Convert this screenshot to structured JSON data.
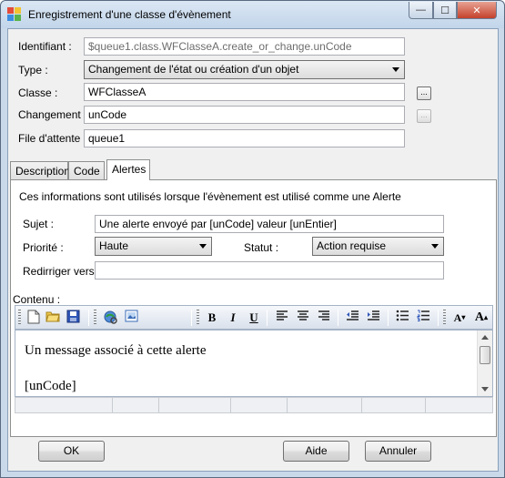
{
  "window": {
    "title": "Enregistrement d'une classe d'évènement",
    "controls": {
      "minimize": "—",
      "maximize": "☐",
      "close": "✕"
    }
  },
  "form": {
    "identifiant": {
      "label": "Identifiant :",
      "value": "$queue1.class.WFClasseA.create_or_change.unCode"
    },
    "type": {
      "label": "Type :",
      "value": "Changement de l'état ou création d'un objet"
    },
    "classe": {
      "label": "Classe :",
      "value": "WFClasseA",
      "button": "..."
    },
    "changement": {
      "label": "Changement :",
      "value": "unCode",
      "button": "..."
    },
    "file_attente": {
      "label": "File d'attente :",
      "value": "queue1"
    }
  },
  "tabs": [
    {
      "label": "Description",
      "active": false
    },
    {
      "label": "Code",
      "active": false
    },
    {
      "label": "Alertes",
      "active": true
    }
  ],
  "alertes": {
    "info": "Ces informations sont utilisés lorsque l'évènement est utilisé comme une Alerte",
    "sujet": {
      "label": "Sujet :",
      "value": "Une alerte envoyé par [unCode] valeur [unEntier]"
    },
    "priorite": {
      "label": "Priorité :",
      "value": "Haute"
    },
    "statut": {
      "label": "Statut :",
      "value": "Action requise"
    },
    "rediriger": {
      "label": "Redirriger vers :",
      "value": ""
    },
    "contenu": {
      "label": "Contenu :",
      "toolbar": {
        "new": "new-document-icon",
        "open": "open-folder-icon",
        "save": "save-icon",
        "link": "link-icon",
        "image": "insert-image-icon",
        "bold": "B",
        "italic": "I",
        "underline": "U",
        "align_left": "align-left-icon",
        "align_center": "align-center-icon",
        "align_right": "align-right-icon",
        "outdent": "outdent-icon",
        "indent": "indent-icon",
        "bullets": "bullet-list-icon",
        "numbering": "numbered-list-icon",
        "font_smaller": "A",
        "font_bigger": "A"
      },
      "lines": [
        "Un message associé à cette alerte",
        "[unCode]"
      ]
    }
  },
  "buttons": {
    "ok": "OK",
    "aide": "Aide",
    "annuler": "Annuler"
  }
}
